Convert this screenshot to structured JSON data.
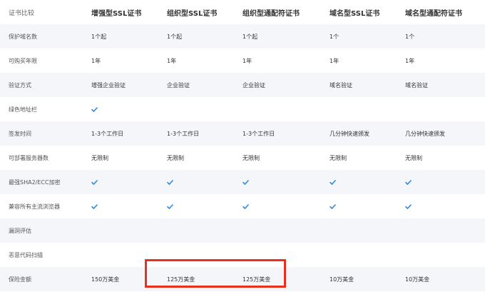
{
  "table": {
    "headers": [
      "证书比较",
      "增强型SSL证书",
      "组织型SSL证书",
      "组织型通配符证书",
      "域名型SSL证书",
      "域名型通配符证书"
    ],
    "rows": [
      {
        "label": "保护域名数",
        "cells": [
          {
            "text": "1个起"
          },
          {
            "text": "1个起"
          },
          {
            "text": "1个起"
          },
          {
            "text": "1个"
          },
          {
            "text": "1个"
          }
        ]
      },
      {
        "label": "可购买年限",
        "cells": [
          {
            "text": "1年"
          },
          {
            "text": "1年"
          },
          {
            "text": "1年"
          },
          {
            "text": "1年"
          },
          {
            "text": "1年"
          }
        ]
      },
      {
        "label": "验证方式",
        "cells": [
          {
            "text": "增强企业验证"
          },
          {
            "text": "企业验证"
          },
          {
            "text": "企业验证"
          },
          {
            "text": "域名验证"
          },
          {
            "text": "域名验证"
          }
        ]
      },
      {
        "label": "绿色地址栏",
        "cells": [
          {
            "check": true
          },
          {
            "text": ""
          },
          {
            "text": ""
          },
          {
            "text": ""
          },
          {
            "text": ""
          }
        ]
      },
      {
        "label": "签发时间",
        "cells": [
          {
            "text": "1-3个工作日"
          },
          {
            "text": "1-3个工作日"
          },
          {
            "text": "1-3个工作日"
          },
          {
            "text": "几分钟快速颁发"
          },
          {
            "text": "几分钟快速颁发"
          }
        ]
      },
      {
        "label": "可部署服务器数",
        "cells": [
          {
            "text": "无限制"
          },
          {
            "text": "无限制"
          },
          {
            "text": "无限制"
          },
          {
            "text": "无限制"
          },
          {
            "text": "无限制"
          }
        ]
      },
      {
        "label": "最强SHA2/ECC加密",
        "cells": [
          {
            "check": true
          },
          {
            "check": true
          },
          {
            "check": true
          },
          {
            "check": true
          },
          {
            "check": true
          }
        ]
      },
      {
        "label": "兼容所有主流浏览器",
        "cells": [
          {
            "check": true
          },
          {
            "check": true
          },
          {
            "check": true
          },
          {
            "check": true
          },
          {
            "check": true
          }
        ]
      },
      {
        "label": "漏洞评估",
        "cells": [
          {
            "text": ""
          },
          {
            "text": ""
          },
          {
            "text": ""
          },
          {
            "text": ""
          },
          {
            "text": ""
          }
        ]
      },
      {
        "label": "恶意代码扫描",
        "cells": [
          {
            "text": ""
          },
          {
            "text": ""
          },
          {
            "text": ""
          },
          {
            "text": ""
          },
          {
            "text": ""
          }
        ]
      },
      {
        "label": "保险金额",
        "cells": [
          {
            "text": "150万美金"
          },
          {
            "text": "125万美金"
          },
          {
            "text": "125万美金"
          },
          {
            "text": "10万美金"
          },
          {
            "text": "10万美金"
          }
        ]
      }
    ]
  },
  "colors": {
    "check": "#2b8be8",
    "highlight": "#e8301f",
    "stripe": "#f4f6f9"
  },
  "icons": {
    "check": "check-icon"
  }
}
